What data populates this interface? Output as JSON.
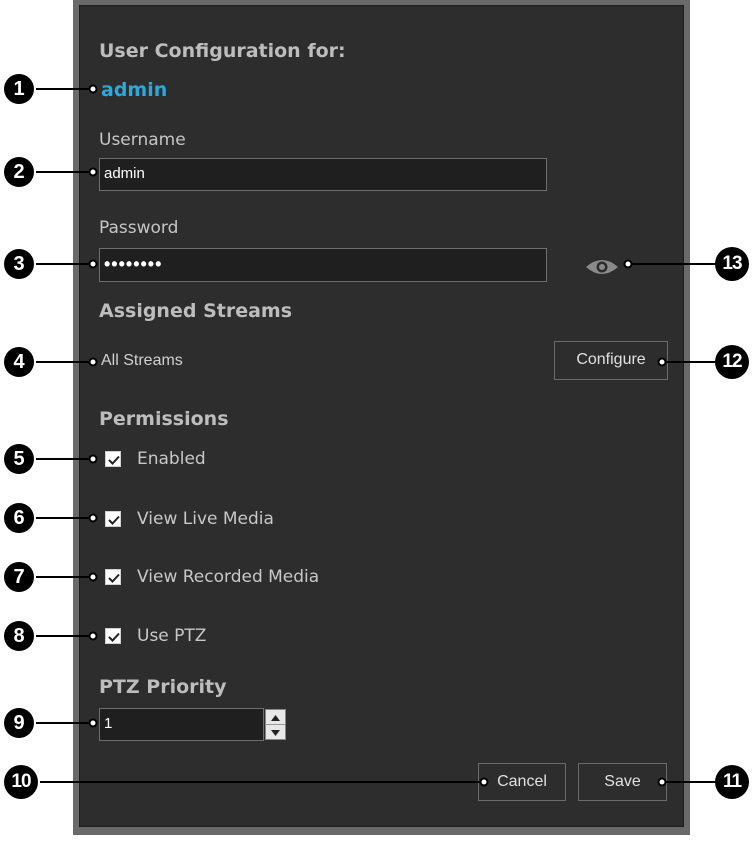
{
  "dialog": {
    "title": "User Configuration for:",
    "user": "admin"
  },
  "username": {
    "label": "Username",
    "value": "admin"
  },
  "password": {
    "label": "Password",
    "value": "••••••••",
    "reveal_icon": "eye-icon"
  },
  "streams": {
    "heading": "Assigned Streams",
    "value": "All Streams",
    "configure_label": "Configure"
  },
  "permissions": {
    "heading": "Permissions",
    "items": [
      {
        "label": "Enabled",
        "checked": true
      },
      {
        "label": "View Live Media",
        "checked": true
      },
      {
        "label": "View Recorded Media",
        "checked": true
      },
      {
        "label": "Use PTZ",
        "checked": true
      }
    ]
  },
  "ptz": {
    "heading": "PTZ Priority",
    "value": "1"
  },
  "buttons": {
    "cancel_label": "Cancel",
    "save_label": "Save"
  },
  "callouts": [
    "1",
    "2",
    "3",
    "4",
    "5",
    "6",
    "7",
    "8",
    "9",
    "10",
    "11",
    "12",
    "13"
  ],
  "colors": {
    "accent": "#29a9e0",
    "panel": "#2d2d2d"
  }
}
